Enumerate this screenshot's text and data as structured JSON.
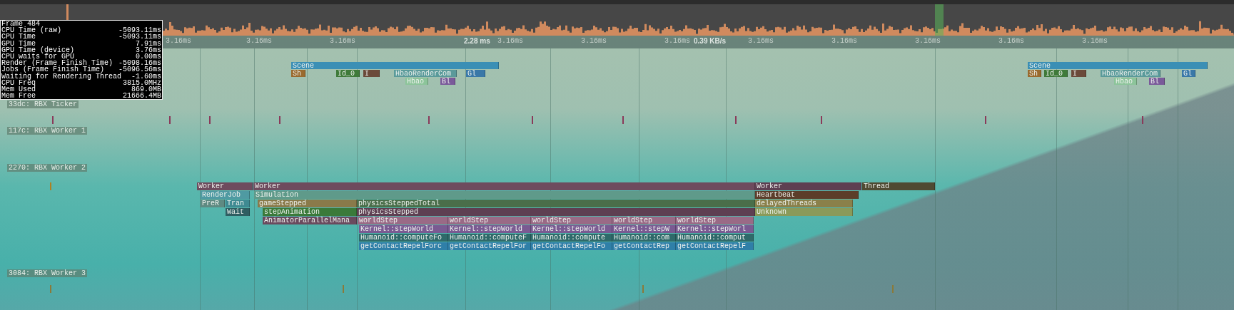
{
  "stats": {
    "title": "Frame 484",
    "rows": [
      {
        "label": "CPU Time (raw)",
        "value": "-5093.11ms"
      },
      {
        "label": "CPU Time",
        "value": "-5093.11ms"
      },
      {
        "label": "GPU Time",
        "value": "7.91ms"
      },
      {
        "label": "GPU Time (device)",
        "value": "3.76ms"
      },
      {
        "label": "CPU waits for GPU",
        "value": "0.00ms"
      },
      {
        "label": "Render (Frame Finish Time)",
        "value": "-5098.16ms"
      },
      {
        "label": "Jobs (Frame Finish Time)",
        "value": "-5096.56ms"
      },
      {
        "label": "Waiting for Rendering Thread",
        "value": "-1.60ms"
      },
      {
        "label": "CPU Freq",
        "value": "3815.0MHz"
      },
      {
        "label": "Mem Used",
        "value": "869.0MB"
      },
      {
        "label": "Mem Free",
        "value": "21666.4MB"
      }
    ]
  },
  "ticks": [
    {
      "label": "3.16ms",
      "kind": "time"
    },
    {
      "label": "3.16ms",
      "kind": "time"
    },
    {
      "label": "3.16ms",
      "kind": "time"
    },
    {
      "label": "2.28 ms",
      "kind": "rate"
    },
    {
      "label": "3.16ms",
      "kind": "time"
    },
    {
      "label": "3.16ms",
      "kind": "time"
    },
    {
      "label": "3.16ms",
      "kind": "time"
    },
    {
      "label": "0.39 KB/s",
      "kind": "rate"
    },
    {
      "label": "3.16ms",
      "kind": "time"
    },
    {
      "label": "3.16ms",
      "kind": "time"
    },
    {
      "label": "3.16ms",
      "kind": "time"
    },
    {
      "label": "3.16ms",
      "kind": "time"
    },
    {
      "label": "3.16ms",
      "kind": "time"
    }
  ],
  "threads": [
    {
      "label": "33dc: RBX Ticker"
    },
    {
      "label": "117c: RBX Worker 1"
    },
    {
      "label": "2270: RBX Worker 2"
    },
    {
      "label": "3084: RBX Worker 3"
    }
  ],
  "render_stacks": [
    {
      "rows": [
        {
          "blocks": [
            {
              "label": "Scene",
              "color": "#3b8fb5"
            }
          ]
        },
        {
          "blocks": [
            {
              "label": "Sh",
              "color": "#9a6a2e"
            },
            {
              "label": "Id_0",
              "color": "#3f7a3a"
            },
            {
              "label": "I",
              "color": "#6b4a3a"
            },
            {
              "label": "HbaoRenderCom",
              "color": "#5a9a9a"
            },
            {
              "label": "Gl",
              "color": "#3a78a8"
            }
          ]
        },
        {
          "blocks": [
            {
              "label": "Hbao",
              "color": "#8cc49a"
            },
            {
              "label": "Bl",
              "color": "#7a5a9a"
            }
          ]
        }
      ]
    },
    {
      "rows": [
        {
          "blocks": [
            {
              "label": "Scene",
              "color": "#3b8fb5"
            }
          ]
        },
        {
          "blocks": [
            {
              "label": "Sh",
              "color": "#9a6a2e"
            },
            {
              "label": "Id_0",
              "color": "#3f7a3a"
            },
            {
              "label": "I",
              "color": "#6b4a3a"
            },
            {
              "label": "HbaoRenderCom",
              "color": "#5a9a9a"
            },
            {
              "label": "Gl",
              "color": "#3a78a8"
            }
          ]
        },
        {
          "blocks": [
            {
              "label": "Hbao",
              "color": "#8cc49a"
            },
            {
              "label": "Bl",
              "color": "#7a5a9a"
            }
          ]
        }
      ]
    }
  ],
  "worker_stack": {
    "rows": [
      {
        "blocks": [
          {
            "label": "Worker",
            "color": "#6e4b5e"
          },
          {
            "label": "Worker",
            "color": "#6e4b5e"
          },
          {
            "label": "Worker",
            "color": "#5e3f52"
          },
          {
            "label": "Thread",
            "color": "#4f4a32"
          }
        ]
      },
      {
        "blocks": [
          {
            "label": "RenderJob",
            "color": "#4f9aa2"
          },
          {
            "label": "Simulation",
            "color": "#5f9a8a"
          },
          {
            "label": "Heartbeat",
            "color": "#5c3d2a"
          }
        ]
      },
      {
        "blocks": [
          {
            "label": "PreR",
            "color": "#5f8a82"
          },
          {
            "label": "Tran",
            "color": "#3f8a92"
          },
          {
            "label": "gameStepped",
            "color": "#8a7a4a"
          },
          {
            "label": "physicsSteppedTotal",
            "color": "#4a6e4a"
          },
          {
            "label": "delayedThreads",
            "color": "#8a804a"
          }
        ]
      },
      {
        "blocks": [
          {
            "label": "Wait",
            "color": "#2f5e62"
          },
          {
            "label": "stepAnimation",
            "color": "#3a7a3a"
          },
          {
            "label": "physicsStepped",
            "color": "#5e3f52"
          },
          {
            "label": "Unknown",
            "color": "#8a9a5a"
          }
        ]
      },
      {
        "blocks": [
          {
            "label": "AnimatorParallelMana",
            "color": "#6a4a5e"
          },
          {
            "label": "worldStep",
            "color": "#9a6a86"
          },
          {
            "label": "worldStep",
            "color": "#9a6a86"
          },
          {
            "label": "worldStep",
            "color": "#9a6a86"
          },
          {
            "label": "worldStep",
            "color": "#9a6a86"
          },
          {
            "label": "worldStep",
            "color": "#9a6a86"
          }
        ]
      },
      {
        "blocks": [
          {
            "label": "Kernel::stepWorld",
            "color": "#7a5a92"
          },
          {
            "label": "Kernel::stepWorld",
            "color": "#7a5a92"
          },
          {
            "label": "Kernel::stepWorld",
            "color": "#7a5a92"
          },
          {
            "label": "Kernel::stepW",
            "color": "#7a5a92"
          },
          {
            "label": "Kernel::stepWorl",
            "color": "#7a5a92"
          }
        ]
      },
      {
        "blocks": [
          {
            "label": "Humanoid::computeFo",
            "color": "#2f6a6a"
          },
          {
            "label": "Humanoid::computeF",
            "color": "#2f6a6a"
          },
          {
            "label": "Humanoid::compute",
            "color": "#2f6a6a"
          },
          {
            "label": "Humanoid::com",
            "color": "#2f6a6a"
          },
          {
            "label": "Humanoid::comput",
            "color": "#2f6a6a"
          }
        ]
      },
      {
        "blocks": [
          {
            "label": "getContactRepelForc",
            "color": "#2f7fa8"
          },
          {
            "label": "getContactRepelFor",
            "color": "#2f7fa8"
          },
          {
            "label": "getContactRepelFo",
            "color": "#2f7fa8"
          },
          {
            "label": "getContactRep",
            "color": "#2f7fa8"
          },
          {
            "label": "getContactRepelF",
            "color": "#2f7fa8"
          }
        ]
      }
    ]
  }
}
